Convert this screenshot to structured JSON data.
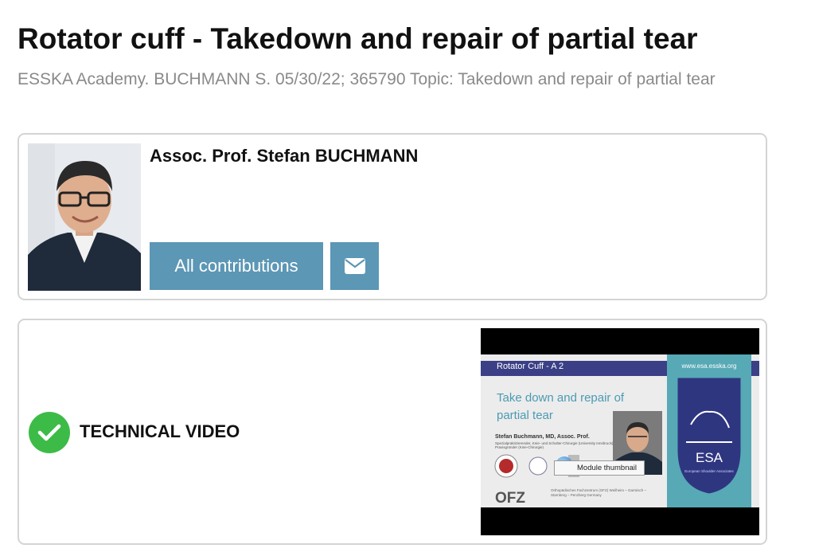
{
  "page": {
    "title": "Rotator cuff - Takedown and repair of partial tear",
    "subtitle": "ESSKA Academy. BUCHMANN S. 05/30/22; 365790 Topic: Takedown and repair of partial tear"
  },
  "author": {
    "name": "Assoc. Prof. Stefan BUCHMANN",
    "contributions_label": "All contributions",
    "mail_icon": "envelope-icon"
  },
  "video": {
    "label": "TECHNICAL VIDEO",
    "status_icon": "check-circle-icon",
    "tooltip": "Module thumbnail",
    "slide": {
      "bar_title": "Rotator Cuff - A 2",
      "esa_url": "www.esa.esska.org",
      "heading": "Take down and repair of partial tear",
      "speaker": "Stefan Buchmann, MD, Assoc. Prof.",
      "speaker_details": "Spezialpraktizierender, Knie- und Schulter-Chirurgie (University Innsbruck) Praxisgründer (Knie-Chirurgie)",
      "esa_badge": "ESA",
      "esa_badge_sub": "European Shoulder Associates",
      "ofz_logo": "OFZ",
      "ofz_text": "Orthopädisches Fachzentrum (OFZ) Weilheim – Garmisch – Starnberg – Penzberg Germany"
    }
  },
  "colors": {
    "button": "#5c97b5",
    "check": "#3dbb47",
    "esa_teal": "#57a9b6",
    "slide_bar": "#3a3f86"
  }
}
